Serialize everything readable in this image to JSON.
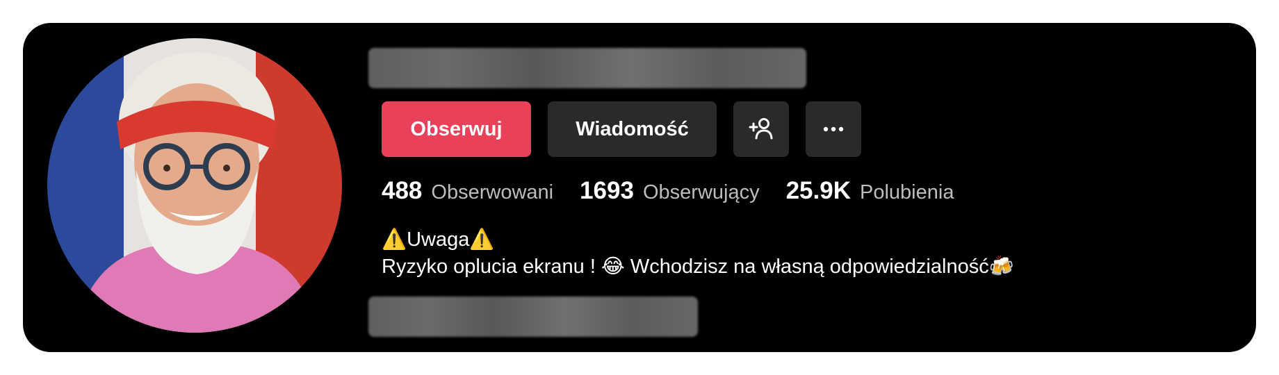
{
  "profile": {
    "buttons": {
      "follow_label": "Obserwuj",
      "message_label": "Wiadomość",
      "suggest_icon": "add-person-icon",
      "more_icon": "more-horizontal-icon"
    },
    "stats": [
      {
        "value": "488",
        "label": "Obserwowani"
      },
      {
        "value": "1693",
        "label": "Obserwujący"
      },
      {
        "value": "25.9K",
        "label": "Polubienia"
      }
    ],
    "bio": {
      "line1": "⚠️Uwaga⚠️",
      "line2": "Ryzyko oplucia ekranu ! 😂 Wchodzisz na własną odpowiedzialność🍻"
    }
  },
  "colors": {
    "background": "#000000",
    "follow_button": "#e9415a",
    "secondary_button": "#2a2a2a",
    "stat_label": "#bdbdbd"
  }
}
